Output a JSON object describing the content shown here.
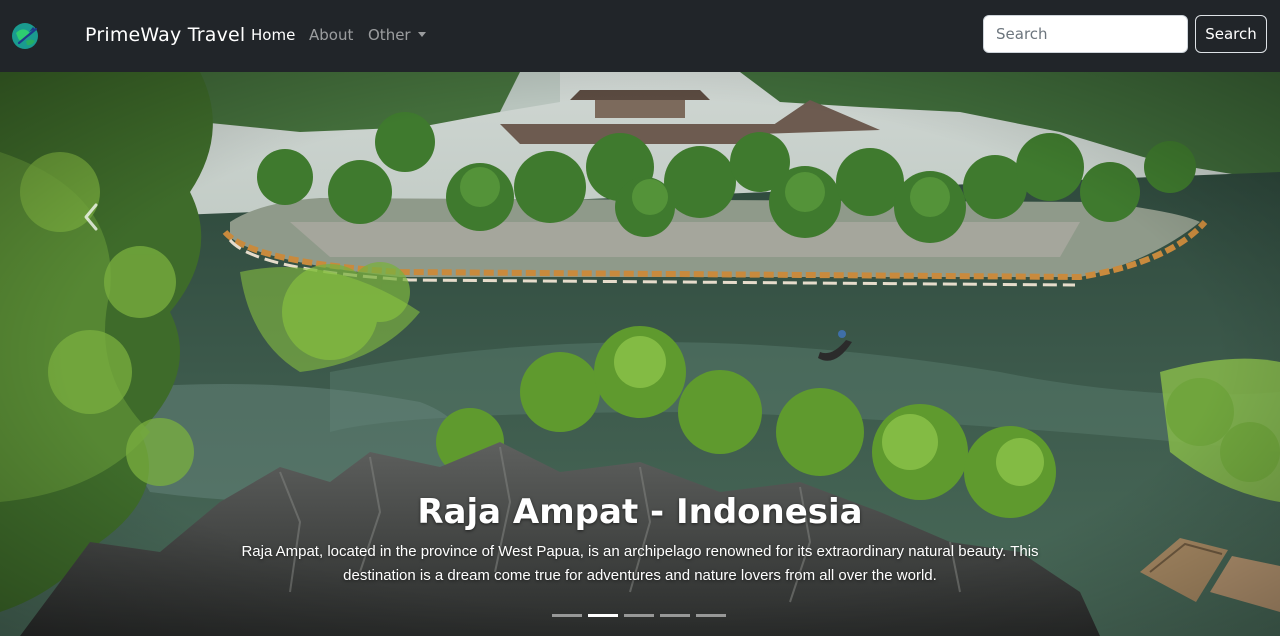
{
  "navbar": {
    "brand": "PrimeWay Travel",
    "links": [
      {
        "label": "Home",
        "active": true
      },
      {
        "label": "About",
        "active": false
      },
      {
        "label": "Other",
        "active": false,
        "dropdown": true
      }
    ],
    "search": {
      "placeholder": "Search",
      "value": ""
    },
    "search_button_label": "Search",
    "logo_icon": "globe-plane-icon"
  },
  "carousel": {
    "slide": {
      "title": "Raja Ampat - Indonesia",
      "description": "Raja Ampat, located in the province of West Papua, is an archipelago renowned for its extraordinary natural beauty. This destination is a dream come true for adventures and nature lovers from all over the world."
    },
    "indicator_count": 5,
    "active_indicator": 2,
    "prev_icon": "chevron-left-icon"
  },
  "colors": {
    "navbar_bg": "#212529",
    "text_light": "#ffffff",
    "text_muted": "rgba(255,255,255,0.55)"
  }
}
